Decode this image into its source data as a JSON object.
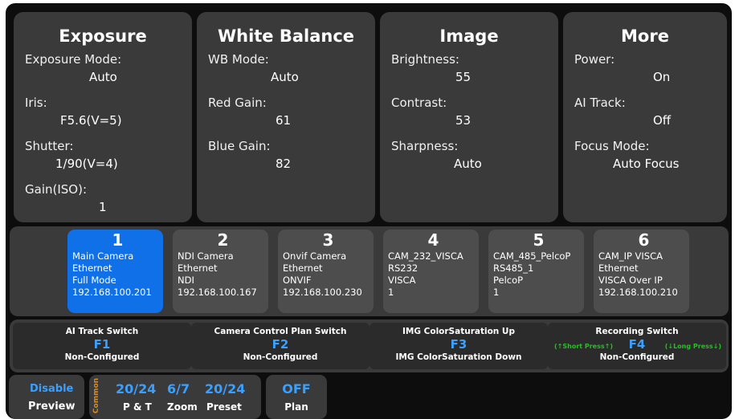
{
  "exposure": {
    "title": "Exposure",
    "mode_label": "Exposure Mode:",
    "mode_value": "Auto",
    "iris_label": "Iris:",
    "iris_value": "F5.6(V=5)",
    "shutter_label": "Shutter:",
    "shutter_value": "1/90(V=4)",
    "gain_label": "Gain(ISO):",
    "gain_value": "1"
  },
  "white_balance": {
    "title": "White Balance",
    "mode_label": "WB Mode:",
    "mode_value": "Auto",
    "red_label": "Red Gain:",
    "red_value": "61",
    "blue_label": "Blue Gain:",
    "blue_value": "82"
  },
  "image": {
    "title": "Image",
    "brightness_label": "Brightness:",
    "brightness_value": "55",
    "contrast_label": "Contrast:",
    "contrast_value": "53",
    "sharpness_label": "Sharpness:",
    "sharpness_value": "Auto"
  },
  "more": {
    "title": "More",
    "power_label": "Power:",
    "power_value": "On",
    "ai_label": "AI Track:",
    "ai_value": "Off",
    "focus_label": "Focus Mode:",
    "focus_value": "Auto Focus"
  },
  "cameras": [
    {
      "number": "1",
      "name": "Main Camera",
      "conn": "Ethernet",
      "proto": "Full Mode",
      "addr": "192.168.100.201",
      "active": true
    },
    {
      "number": "2",
      "name": "NDI Camera",
      "conn": "Ethernet",
      "proto": "NDI",
      "addr": "192.168.100.167"
    },
    {
      "number": "3",
      "name": "Onvif Camera",
      "conn": "Ethernet",
      "proto": "ONVIF",
      "addr": "192.168.100.230"
    },
    {
      "number": "4",
      "name": "CAM_232_VISCA",
      "conn": "RS232",
      "proto": "VISCA",
      "addr": "1"
    },
    {
      "number": "5",
      "name": "CAM_485_PelcoP",
      "conn": "RS485_1",
      "proto": "PelcoP",
      "addr": "1"
    },
    {
      "number": "6",
      "name": "CAM_IP VISCA",
      "conn": "Ethernet",
      "proto": "VISCA Over IP",
      "addr": "192.168.100.210"
    }
  ],
  "function_keys": [
    {
      "title": "AI Track Switch",
      "key": "F1",
      "bottom": "Non-Configured"
    },
    {
      "title": "Camera Control Plan Switch",
      "key": "F2",
      "bottom": "Non-Configured"
    },
    {
      "title": "IMG ColorSaturation Up",
      "key": "F3",
      "bottom": "IMG ColorSaturation Down"
    },
    {
      "title": "Recording Switch",
      "key": "F4",
      "bottom": "Non-Configured",
      "short_note": "(↑Short Press↑)",
      "long_note": "(↓Long Press↓)"
    }
  ],
  "bottom_bar": {
    "preview_status": "Disable",
    "preview_label": "Preview",
    "common_label": "Common",
    "pt_value": "20/24",
    "pt_label": "P & T",
    "zoom_value": "6/7",
    "zoom_label": "Zoom",
    "preset_value": "20/24",
    "preset_label": "Preset",
    "plan_status": "OFF",
    "plan_label": "Plan"
  },
  "colors": {
    "active_camera": "#1070e8",
    "key_blue": "#3aa0ff",
    "note_green": "#26c026",
    "common_orange": "#d98c1a"
  }
}
